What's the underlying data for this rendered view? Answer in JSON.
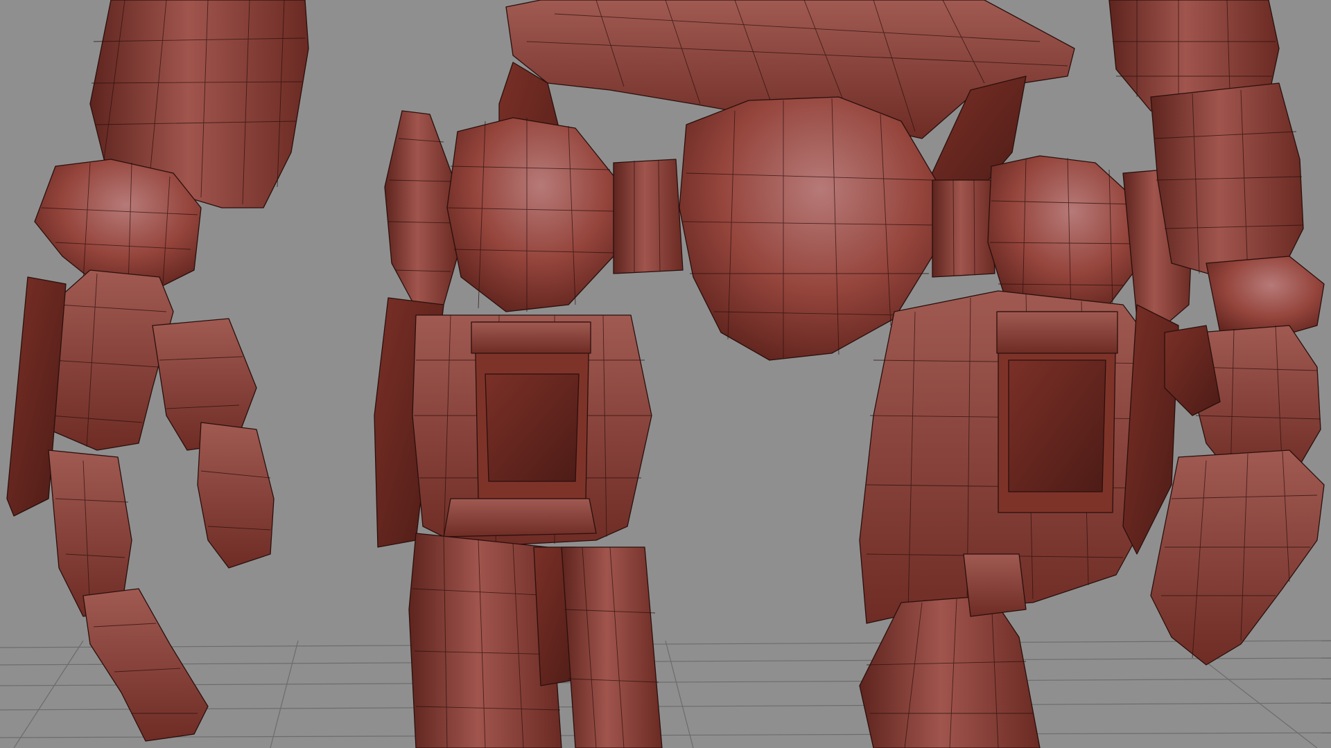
{
  "viewport": {
    "background": "#8f8f8f",
    "grid_color": "#6c6c6c"
  },
  "model": {
    "base_color": "#8e3a30",
    "highlight_color": "#b8706a",
    "shadow_color": "#5a211b",
    "wire_color": "#2a0f0c",
    "display_mode": "shaded-wireframe"
  }
}
